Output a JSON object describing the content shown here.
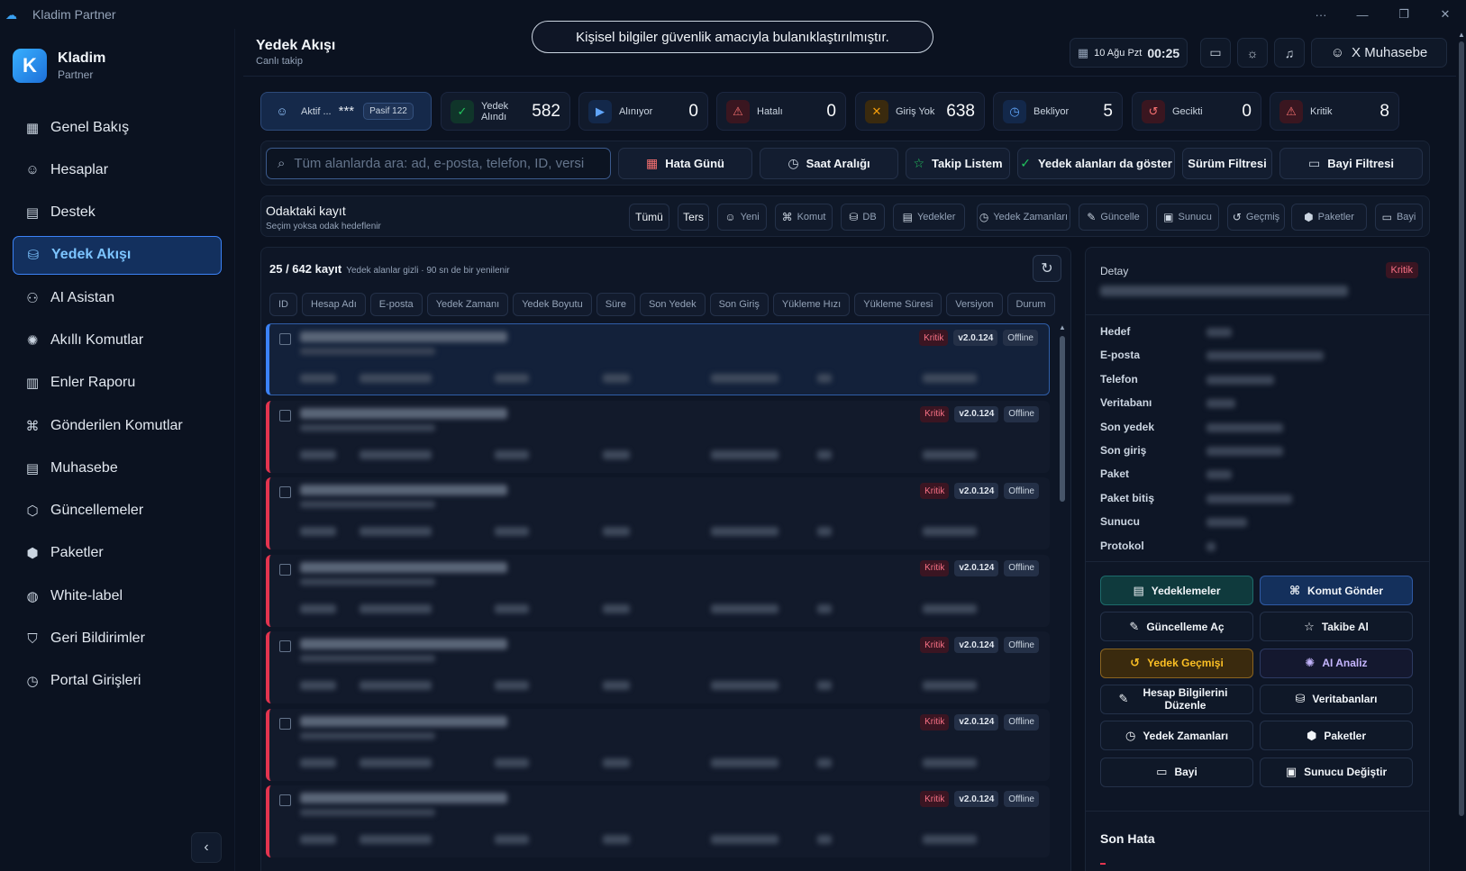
{
  "window": {
    "title": "Kladim Partner",
    "controls": [
      "···",
      "—",
      "❐",
      "✕"
    ]
  },
  "brand": {
    "name": "Kladim",
    "sub": "Partner",
    "logo_letter": "K"
  },
  "nav": [
    {
      "label": "Genel Bakış",
      "icon": "grid-icon",
      "glyph": "▦"
    },
    {
      "label": "Hesaplar",
      "icon": "users-icon",
      "glyph": "☺"
    },
    {
      "label": "Destek",
      "icon": "ticket-icon",
      "glyph": "▤"
    },
    {
      "label": "Yedek Akışı",
      "icon": "backup-flow-icon",
      "glyph": "⛁",
      "active": true
    },
    {
      "label": "AI Asistan",
      "icon": "bot-icon",
      "glyph": "⚇"
    },
    {
      "label": "Akıllı Komutlar",
      "icon": "brain-icon",
      "glyph": "✺"
    },
    {
      "label": "Enler Raporu",
      "icon": "bar-chart-icon",
      "glyph": "▥"
    },
    {
      "label": "Gönderilen Komutlar",
      "icon": "command-icon",
      "glyph": "⌘"
    },
    {
      "label": "Muhasebe",
      "icon": "receipt-icon",
      "glyph": "▤"
    },
    {
      "label": "Güncellemeler",
      "icon": "package-icon",
      "glyph": "⬡"
    },
    {
      "label": "Paketler",
      "icon": "boxes-icon",
      "glyph": "⬢"
    },
    {
      "label": "White-label",
      "icon": "palette-icon",
      "glyph": "◍"
    },
    {
      "label": "Geri Bildirimler",
      "icon": "shield-icon",
      "glyph": "⛉"
    },
    {
      "label": "Portal Girişleri",
      "icon": "clock-icon",
      "glyph": "◷"
    }
  ],
  "collapse_glyph": "‹",
  "header": {
    "title": "Yedek Akışı",
    "subtitle": "Canlı takip",
    "privacy_notice": "Kişisel bilgiler güvenlik amacıyla bulanıklaştırılmıştır.",
    "date": "10 Ağu Pzt",
    "time": "00:25",
    "user": "X Muhasebe"
  },
  "stats": {
    "aktif": {
      "label": "Aktif ...",
      "value": "***",
      "pasif": "Pasif 122"
    },
    "items": [
      {
        "label": "Yedek Alındı",
        "value": "582",
        "icon": "check-circle-icon",
        "glyph": "✓",
        "color": "#22c55e",
        "bg": "#10352a"
      },
      {
        "label": "Alınıyor",
        "value": "0",
        "icon": "play-circle-icon",
        "glyph": "▶",
        "color": "#60a5fa",
        "bg": "#13284a"
      },
      {
        "label": "Hatalı",
        "value": "0",
        "icon": "warning-icon",
        "glyph": "⚠",
        "color": "#f87171",
        "bg": "#3a1620"
      },
      {
        "label": "Giriş Yok",
        "value": "638",
        "icon": "wifi-off-icon",
        "glyph": "✕",
        "color": "#f59e0b",
        "bg": "#3a2a0e"
      },
      {
        "label": "Bekliyor",
        "value": "5",
        "icon": "clock-icon",
        "glyph": "◷",
        "color": "#60a5fa",
        "bg": "#13284a"
      },
      {
        "label": "Gecikti",
        "value": "0",
        "icon": "history-icon",
        "glyph": "↺",
        "color": "#f87171",
        "bg": "#3a1620"
      },
      {
        "label": "Kritik",
        "value": "8",
        "icon": "alert-triangle-icon",
        "glyph": "⚠",
        "color": "#f87171",
        "bg": "#3a1620"
      }
    ]
  },
  "search": {
    "placeholder": "Tüm alanlarda ara: ad, e-posta, telefon, ID, versi"
  },
  "filters": [
    {
      "label": "Hata Günü",
      "icon": "calendar-icon",
      "glyph": "▦",
      "color": "#f87171"
    },
    {
      "label": "Saat Aralığı",
      "icon": "clock-icon",
      "glyph": "◷",
      "color": "#cbd5e1"
    },
    {
      "label": "Takip Listem",
      "icon": "star-icon",
      "glyph": "☆",
      "color": "#22c55e"
    },
    {
      "label": "Yedek alanları da göster",
      "icon": "check-circle-icon",
      "glyph": "✓",
      "color": "#22c55e"
    },
    {
      "label": "Sürüm Filtresi",
      "icon": "",
      "glyph": "",
      "color": "#cbd5e1"
    },
    {
      "label": "Bayi Filtresi",
      "icon": "store-icon",
      "glyph": "▭",
      "color": "#cbd5e1"
    }
  ],
  "focus": {
    "title": "Odaktaki kayıt",
    "subtitle": "Seçim yoksa odak hedeflenir",
    "buttons": [
      {
        "label": "Tümü",
        "glyph": ""
      },
      {
        "label": "Ters",
        "glyph": ""
      },
      {
        "label": "Yeni",
        "glyph": "☺",
        "icon": "user-plus-icon"
      },
      {
        "label": "Komut",
        "glyph": "⌘",
        "icon": "command-icon"
      },
      {
        "label": "DB",
        "glyph": "⛁",
        "icon": "database-icon"
      },
      {
        "label": "Yedekler",
        "glyph": "▤",
        "icon": "archive-icon"
      },
      {
        "label": "Yedek Zamanları",
        "glyph": "◷",
        "icon": "clock-icon"
      },
      {
        "label": "Güncelle",
        "glyph": "✎",
        "icon": "wrench-icon"
      },
      {
        "label": "Sunucu",
        "glyph": "▣",
        "icon": "server-icon"
      },
      {
        "label": "Geçmiş",
        "glyph": "↺",
        "icon": "history-icon"
      },
      {
        "label": "Paketler",
        "glyph": "⬢",
        "icon": "boxes-icon"
      },
      {
        "label": "Bayi",
        "glyph": "▭",
        "icon": "store-icon"
      }
    ]
  },
  "list": {
    "count": "25 / 642 kayıt",
    "note": "Yedek alanlar gizli · 90 sn de bir yenilenir",
    "columns": [
      "ID",
      "Hesap Adı",
      "E-posta",
      "Yedek Zamanı",
      "Yedek Boyutu",
      "Süre",
      "Son Yedek",
      "Son Giriş",
      "Yükleme Hızı",
      "Yükleme Süresi",
      "Versiyon",
      "Durum"
    ],
    "rows": [
      {
        "status": "Kritik",
        "version": "v2.0.124",
        "state": "Offline"
      },
      {
        "status": "Kritik",
        "version": "v2.0.124",
        "state": "Offline"
      },
      {
        "status": "Kritik",
        "version": "v2.0.124",
        "state": "Offline"
      },
      {
        "status": "Kritik",
        "version": "v2.0.124",
        "state": "Offline"
      },
      {
        "status": "Kritik",
        "version": "v2.0.124",
        "state": "Offline"
      },
      {
        "status": "Kritik",
        "version": "v2.0.124",
        "state": "Offline"
      },
      {
        "status": "Kritik",
        "version": "v2.0.124",
        "state": "Offline"
      }
    ]
  },
  "detail": {
    "title": "Detay",
    "status": "Kritik",
    "fields": [
      "Hedef",
      "E-posta",
      "Telefon",
      "Veritabanı",
      "Son yedek",
      "Son giriş",
      "Paket",
      "Paket bitiş",
      "Sunucu",
      "Protokol"
    ],
    "actions": [
      {
        "label": "Yedeklemeler",
        "icon": "archive-icon",
        "glyph": "▤",
        "style": "teal"
      },
      {
        "label": "Komut Gönder",
        "icon": "command-icon",
        "glyph": "⌘",
        "style": "blue"
      },
      {
        "label": "Güncelleme Aç",
        "icon": "wrench-icon",
        "glyph": "✎",
        "style": ""
      },
      {
        "label": "Takibe Al",
        "icon": "star-icon",
        "glyph": "☆",
        "style": ""
      },
      {
        "label": "Yedek Geçmişi",
        "icon": "history-icon",
        "glyph": "↺",
        "style": "amber"
      },
      {
        "label": "AI Analiz",
        "icon": "brain-icon",
        "glyph": "✺",
        "style": "purple"
      },
      {
        "label": "Hesap Bilgilerini Düzenle",
        "icon": "pencil-icon",
        "glyph": "✎",
        "style": ""
      },
      {
        "label": "Veritabanları",
        "icon": "database-icon",
        "glyph": "⛁",
        "style": ""
      },
      {
        "label": "Yedek Zamanları",
        "icon": "clock-icon",
        "glyph": "◷",
        "style": ""
      },
      {
        "label": "Paketler",
        "icon": "boxes-icon",
        "glyph": "⬢",
        "style": ""
      },
      {
        "label": "Bayi",
        "icon": "store-icon",
        "glyph": "▭",
        "style": ""
      },
      {
        "label": "Sunucu Değiştir",
        "icon": "server-icon",
        "glyph": "▣",
        "style": ""
      }
    ],
    "last_error_title": "Son Hata"
  }
}
